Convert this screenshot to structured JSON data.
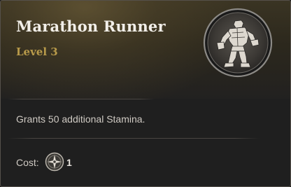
{
  "tooltip": {
    "title": "Marathon Runner",
    "level": "Level 3",
    "description": "Grants 50 additional Stamina.",
    "cost_label": "Cost:",
    "cost_value": "1",
    "cost_icon": "skill-point-icon",
    "badge_icon": "runner-figure-icon"
  },
  "colors": {
    "title": "#f2efe9",
    "level": "#b89a4a",
    "body_text": "#cfcac3",
    "background": "#1f1f1f"
  }
}
